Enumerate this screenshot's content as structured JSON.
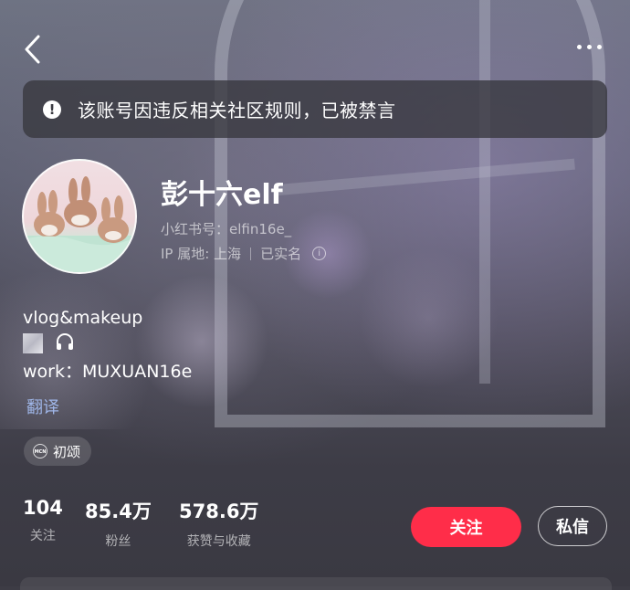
{
  "notice": {
    "text": "该账号因违反相关社区规则，已被禁言"
  },
  "profile": {
    "nickname": "彭十六elf",
    "id_label": "小红书号：",
    "id_value": "elfin16e_",
    "ip_label": "IP 属地: 上海",
    "verified": "已实名"
  },
  "bio": {
    "line1": "vlog&makeup",
    "line3": "work：MUXUAN16e",
    "translate": "翻译"
  },
  "tag": {
    "mcn_text": "MCN",
    "label": "初颂"
  },
  "stats": [
    {
      "value": "104",
      "label": "关注"
    },
    {
      "value": "85.4万",
      "label": "粉丝"
    },
    {
      "value": "578.6万",
      "label": "获赞与收藏"
    }
  ],
  "buttons": {
    "follow": "关注",
    "message": "私信"
  },
  "colors": {
    "follow_button": "#ff2d49",
    "translate_link": "#9fb6e8"
  },
  "icons": [
    "back-icon",
    "more-icon",
    "alert-icon",
    "info-icon",
    "headphones-icon",
    "mcn-icon"
  ]
}
